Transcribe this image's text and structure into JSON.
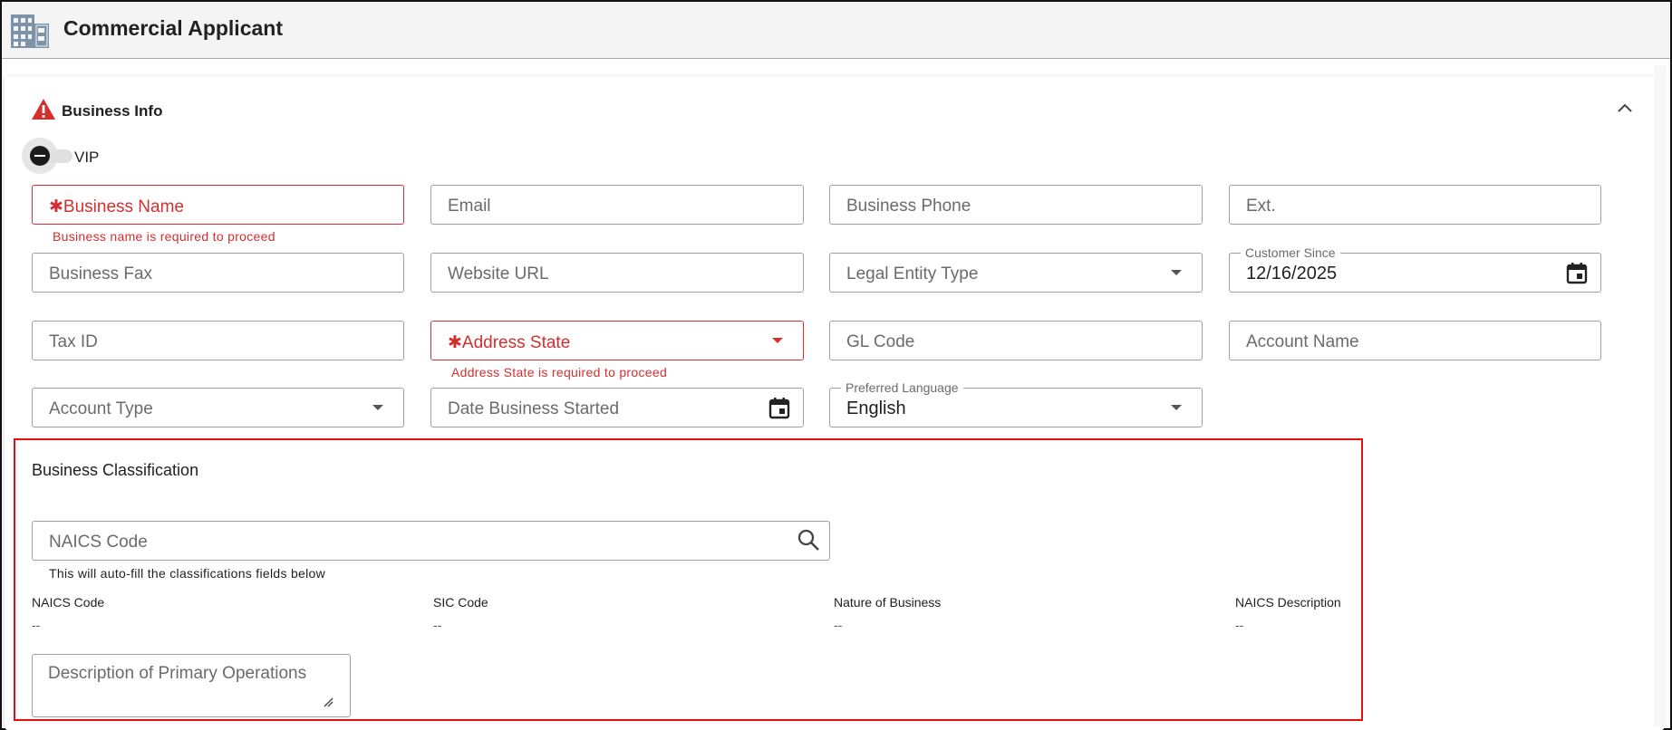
{
  "header": {
    "title": "Commercial Applicant",
    "icon": "building-icon"
  },
  "section": {
    "title": "Business Info",
    "warning_icon": "warning-icon",
    "collapse_icon": "chevron-up-icon"
  },
  "vip": {
    "label": "VIP",
    "checked": false
  },
  "fields": {
    "business_name": {
      "placeholder": "Business Name",
      "required": true,
      "error": "Business name is required to proceed"
    },
    "email": {
      "placeholder": "Email"
    },
    "business_phone": {
      "placeholder": "Business Phone"
    },
    "ext": {
      "placeholder": "Ext."
    },
    "business_fax": {
      "placeholder": "Business Fax"
    },
    "website_url": {
      "placeholder": "Website URL"
    },
    "legal_entity_type": {
      "placeholder": "Legal Entity Type"
    },
    "customer_since": {
      "label": "Customer Since",
      "value": "12/16/2025"
    },
    "tax_id": {
      "placeholder": "Tax ID"
    },
    "address_state": {
      "placeholder": "Address State",
      "required": true,
      "error": "Address State is required to proceed"
    },
    "gl_code": {
      "placeholder": "GL Code"
    },
    "account_name": {
      "placeholder": "Account Name"
    },
    "account_type": {
      "placeholder": "Account Type"
    },
    "date_business_started": {
      "placeholder": "Date Business Started"
    },
    "preferred_language": {
      "label": "Preferred Language",
      "value": "English"
    }
  },
  "classification": {
    "title": "Business Classification",
    "naics_search": {
      "placeholder": "NAICS Code",
      "helper": "This will auto-fill the classifications fields below"
    },
    "columns": [
      {
        "label": "NAICS Code",
        "value": "--"
      },
      {
        "label": "SIC Code",
        "value": "--"
      },
      {
        "label": "Nature of Business",
        "value": "--"
      },
      {
        "label": "NAICS Description",
        "value": "--"
      }
    ],
    "description": {
      "placeholder": "Description of Primary Operations"
    }
  },
  "colors": {
    "error": "#d32f2f",
    "highlight_border": "#e01010",
    "header_bg": "#f4f4f4"
  }
}
